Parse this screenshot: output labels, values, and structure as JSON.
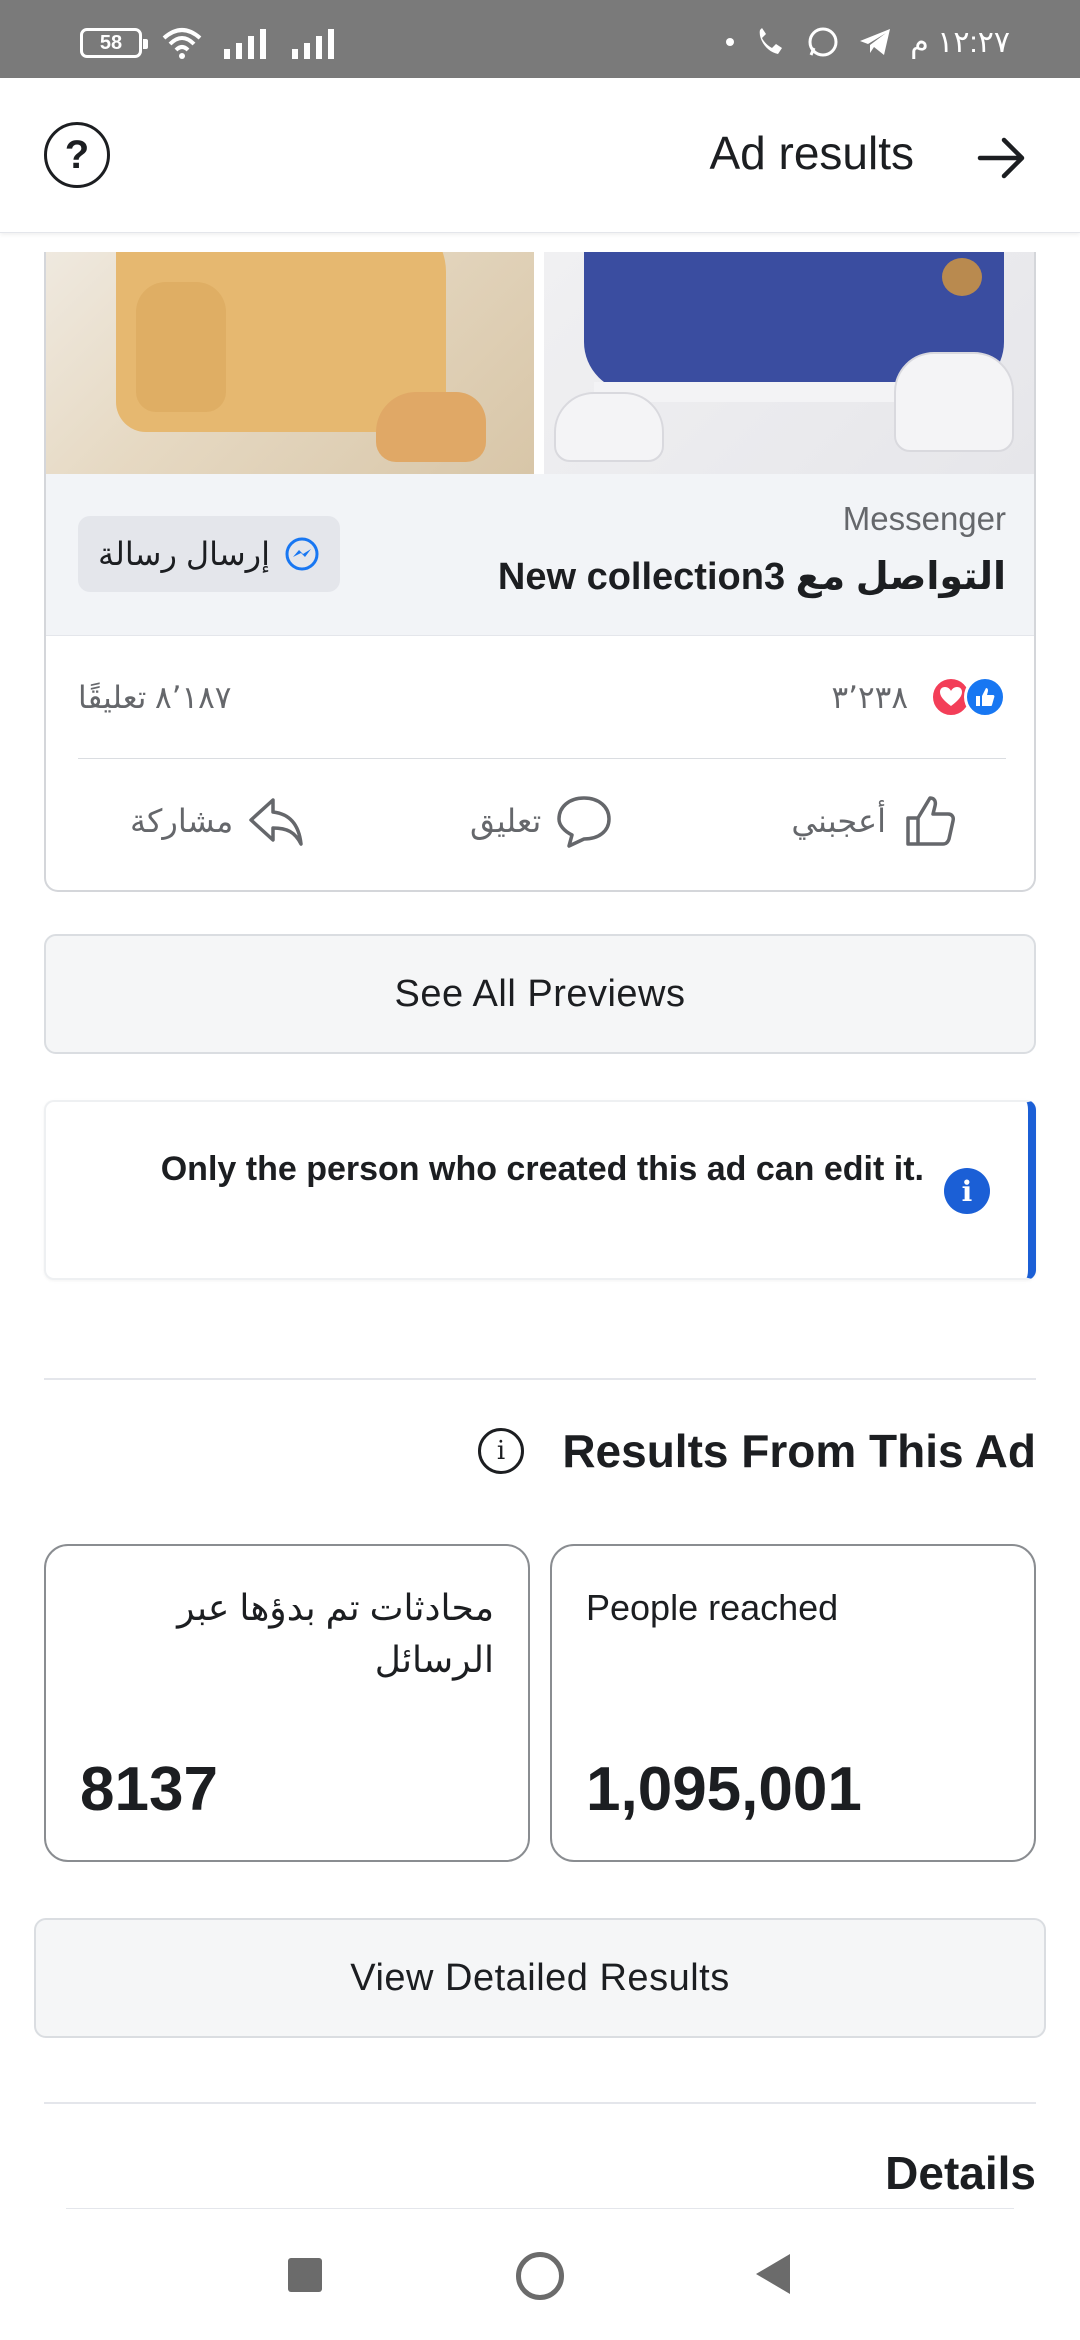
{
  "status_bar": {
    "battery": "58",
    "time": "١٢:٢٧ م"
  },
  "header": {
    "title": "Ad results",
    "help_icon": "question-circle-icon",
    "forward_icon": "arrow-right-icon"
  },
  "ad_preview": {
    "cta_label": "Messenger",
    "headline": "التواصل مع New collection3",
    "send_button_label": "إرسال رسالة",
    "reaction_count": "٣٬٢٣٨",
    "comment_count": "٨٬١٨٧ تعليقًا",
    "actions": {
      "like": "أعجبني",
      "comment": "تعليق",
      "share": "مشاركة"
    }
  },
  "see_all_previews": "See All Previews",
  "notice": {
    "text": "Only the person who created this ad can edit it."
  },
  "results": {
    "title": "Results From This Ad",
    "metrics": [
      {
        "label": "People reached",
        "value": "1,095,001"
      },
      {
        "label": "محادثات تم بدؤها عبر الرسائل",
        "value": "8137"
      }
    ]
  },
  "view_detailed_results": "View Detailed Results",
  "details_title": "Details",
  "colors": {
    "accent_blue": "#1b5fd6",
    "like_blue": "#1877f2",
    "love_red": "#f33e58"
  }
}
